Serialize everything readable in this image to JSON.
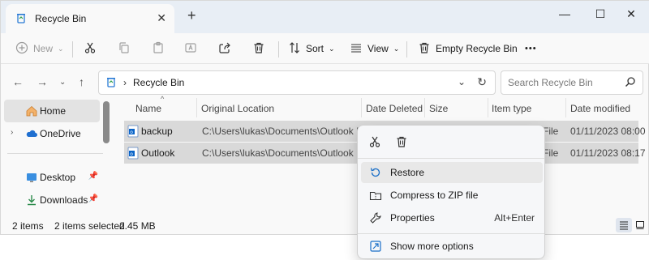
{
  "window": {
    "tab_title": "Recycle Bin",
    "tab_close": "✕",
    "new_tab": "+",
    "minimize": "—",
    "maximize": "☐",
    "close": "✕"
  },
  "toolbar": {
    "new_label": "New",
    "sort_label": "Sort",
    "view_label": "View",
    "empty_label": "Empty Recycle Bin",
    "more_label": "•••"
  },
  "address": {
    "crumb": "Recycle Bin",
    "search_placeholder": "Search Recycle Bin"
  },
  "nav": {
    "items": [
      {
        "label": "Home"
      },
      {
        "label": "OneDrive"
      },
      {
        "label": "Desktop"
      },
      {
        "label": "Downloads"
      }
    ]
  },
  "columns": {
    "name": "Name",
    "original_location": "Original Location",
    "date_deleted": "Date Deleted",
    "size": "Size",
    "item_type": "Item type",
    "date_modified": "Date modified"
  },
  "files": [
    {
      "name": "backup",
      "location": "C:\\Users\\lukas\\Documents\\Outlook Files",
      "type_tail": "File",
      "modified": "01/11/2023 08:00"
    },
    {
      "name": "Outlook",
      "location": "C:\\Users\\lukas\\Documents\\Outlook Files",
      "type_tail": "File",
      "modified": "01/11/2023 08:17"
    }
  ],
  "status": {
    "count": "2 items",
    "selected": "2 items selected",
    "size": "2.45 MB"
  },
  "context_menu": {
    "items": [
      {
        "label": "Restore"
      },
      {
        "label": "Compress to ZIP file"
      },
      {
        "label": "Properties",
        "shortcut": "Alt+Enter"
      },
      {
        "label": "Show more options"
      }
    ]
  },
  "colors": {
    "accent": "#0067c0",
    "selection": "#d9d9d9",
    "titlebar": "#e8eef5"
  }
}
